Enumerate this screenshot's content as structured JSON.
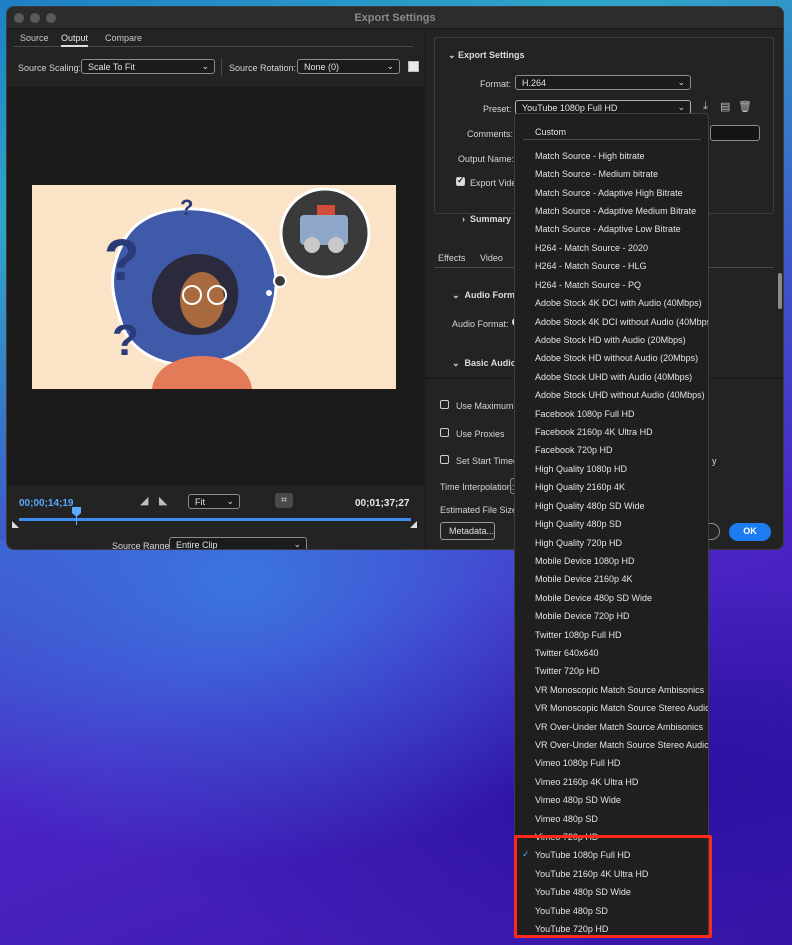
{
  "window": {
    "title": "Export Settings"
  },
  "left": {
    "tabs": [
      {
        "label": "Source"
      },
      {
        "label": "Output"
      },
      {
        "label": "Compare"
      }
    ],
    "source_scaling": {
      "label": "Source Scaling:",
      "value": "Scale To Fit"
    },
    "source_rotation": {
      "label": "Source Rotation:",
      "value": "None (0)"
    },
    "timecode_current": "00;00;14;19",
    "timecode_end": "00;01;37;27",
    "zoom": {
      "value": "Fit"
    },
    "source_range": {
      "label": "Source Range:",
      "value": "Entire Clip"
    }
  },
  "right": {
    "export_settings": {
      "heading": "Export Settings",
      "format": {
        "label": "Format:",
        "value": "H.264"
      },
      "preset": {
        "label": "Preset:",
        "value": "YouTube 1080p Full HD"
      },
      "comments": {
        "label": "Comments:"
      },
      "output_name": {
        "label": "Output Name:"
      },
      "export_video": {
        "label": "Export Vide"
      },
      "summary": {
        "label": "Summary"
      }
    },
    "tabs": [
      {
        "label": "Effects"
      },
      {
        "label": "Video"
      }
    ],
    "audio": {
      "format_section": "Audio Format",
      "format_label": "Audio Format:",
      "basic_section": "Basic Audio S"
    },
    "options": {
      "max_render": "Use Maximum R",
      "proxies": "Use Proxies",
      "start_timecode": "Set Start Timecod",
      "start_timecode_tail": "y",
      "time_interp": "Time Interpolation:",
      "file_size": "Estimated File Size:"
    },
    "buttons": {
      "metadata": "Metadata...",
      "ok": "OK"
    }
  },
  "preset_dropdown": {
    "items": [
      "Custom",
      "Match Source - High bitrate",
      "Match Source - Medium bitrate",
      "Match Source - Adaptive High Bitrate",
      "Match Source - Adaptive Medium Bitrate",
      "Match Source - Adaptive Low Bitrate",
      "H264 - Match Source - 2020",
      "H264 - Match Source - HLG",
      "H264 - Match Source - PQ",
      "Adobe Stock 4K DCI with Audio (40Mbps)",
      "Adobe Stock 4K DCI without Audio (40Mbps)",
      "Adobe Stock HD with Audio (20Mbps)",
      "Adobe Stock HD without Audio (20Mbps)",
      "Adobe Stock UHD with Audio (40Mbps)",
      "Adobe Stock UHD without Audio (40Mbps)",
      "Facebook 1080p Full HD",
      "Facebook 2160p 4K Ultra HD",
      "Facebook 720p HD",
      "High Quality 1080p HD",
      "High Quality 2160p 4K",
      "High Quality 480p SD Wide",
      "High Quality 480p SD",
      "High Quality 720p HD",
      "Mobile Device 1080p HD",
      "Mobile Device 2160p 4K",
      "Mobile Device 480p SD Wide",
      "Mobile Device 720p HD",
      "Twitter 1080p Full HD",
      "Twitter 640x640",
      "Twitter 720p HD",
      "VR Monoscopic Match Source Ambisonics",
      "VR Monoscopic Match Source Stereo Audio",
      "VR Over-Under Match Source Ambisonics",
      "VR Over-Under Match Source Stereo Audio",
      "Vimeo 1080p Full HD",
      "Vimeo 2160p 4K Ultra HD",
      "Vimeo 480p SD Wide",
      "Vimeo 480p SD",
      "Vimeo 720p HD",
      "YouTube 1080p Full HD",
      "YouTube 2160p 4K Ultra HD",
      "YouTube 480p SD Wide",
      "YouTube 480p SD",
      "YouTube 720p HD"
    ],
    "selected": "YouTube 1080p Full HD",
    "checkmark": "✓"
  },
  "colors": {
    "accent": "#1c7cf2",
    "highlight": "#ff2a1a",
    "timecode": "#5aa9ff"
  },
  "icons": [
    "chevron-down-icon",
    "export-preset-icon",
    "import-preset-icon",
    "trash-icon",
    "crop-icon",
    "mark-in-icon",
    "mark-out-icon",
    "playhead-icon"
  ]
}
